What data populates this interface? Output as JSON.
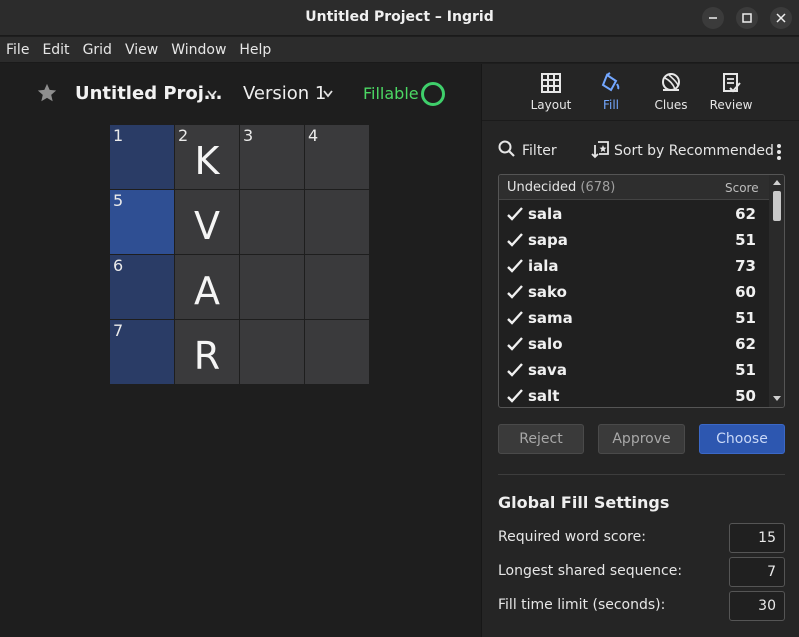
{
  "window": {
    "title": "Untitled Project – Ingrid"
  },
  "menu": [
    "File",
    "Edit",
    "Grid",
    "View",
    "Window",
    "Help"
  ],
  "header": {
    "project_title": "Untitled Proj…",
    "version_label": "Version 1",
    "status_label": "Fillable",
    "status_color": "#4cd964"
  },
  "grid": {
    "rows": 4,
    "cols": 4,
    "numbers": {
      "0-0": "1",
      "0-1": "2",
      "0-2": "3",
      "0-3": "4",
      "1-0": "5",
      "2-0": "6",
      "3-0": "7"
    },
    "letters": {
      "0-1": "K",
      "1-1": "V",
      "2-1": "A",
      "3-1": "R"
    },
    "selected_cell": "1-0",
    "highlighted_column": 0
  },
  "tabs": [
    {
      "label": "Layout",
      "icon": "layout-grid-icon",
      "active": false
    },
    {
      "label": "Fill",
      "icon": "fill-bucket-icon",
      "active": true
    },
    {
      "label": "Clues",
      "icon": "yarn-ball-icon",
      "active": false
    },
    {
      "label": "Review",
      "icon": "review-checklist-icon",
      "active": false
    }
  ],
  "fill": {
    "filter_label": "Filter",
    "sort_label": "Sort by Recommended",
    "list_header": "Undecided",
    "list_count": "(678)",
    "score_header": "Score",
    "words": [
      {
        "word": "sala",
        "score": "62"
      },
      {
        "word": "sapa",
        "score": "51"
      },
      {
        "word": "iala",
        "score": "73"
      },
      {
        "word": "sako",
        "score": "60"
      },
      {
        "word": "sama",
        "score": "51"
      },
      {
        "word": "salo",
        "score": "62"
      },
      {
        "word": "sava",
        "score": "51"
      },
      {
        "word": "salt",
        "score": "50"
      }
    ],
    "buttons": {
      "reject": "Reject",
      "approve": "Approve",
      "choose": "Choose"
    }
  },
  "settings": {
    "title": "Global Fill Settings",
    "required_word_score": {
      "label": "Required word score:",
      "value": "15"
    },
    "longest_shared_sequence": {
      "label": "Longest shared sequence:",
      "value": "7"
    },
    "fill_time_limit": {
      "label": "Fill time limit (seconds):",
      "value": "30"
    }
  }
}
